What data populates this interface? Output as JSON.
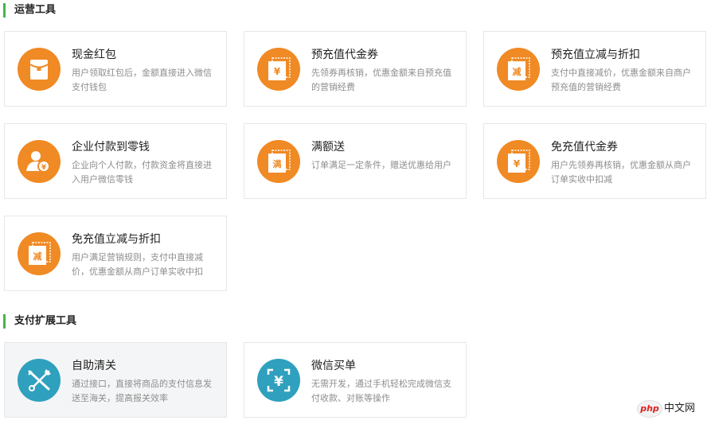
{
  "section1": {
    "title": "运营工具"
  },
  "section2": {
    "title": "支付扩展工具"
  },
  "cards1": [
    {
      "title": "现金红包",
      "desc": "用户领取红包后，金额直接进入微信支付钱包",
      "icon": "red-envelope-icon"
    },
    {
      "title": "预充值代金券",
      "desc": "先领券再核销，优惠金额来自预充值的营销经费",
      "icon": "yen-voucher-icon",
      "glyph": "¥"
    },
    {
      "title": "预充值立减与折扣",
      "desc": "支付中直接减价，优惠金额来自商户预充值的营销经费",
      "icon": "discount-voucher-icon",
      "glyph": "减"
    },
    {
      "title": "企业付款到零钱",
      "desc": "企业向个人付款，付款资金将直接进入用户微信零钱",
      "icon": "enterprise-payment-icon"
    },
    {
      "title": "满额送",
      "desc": "订单满足一定条件，赠送优惠给用户",
      "icon": "full-amount-gift-icon",
      "glyph": "满"
    },
    {
      "title": "免充值代金券",
      "desc": "用户先领券再核销，优惠金额从商户订单实收中扣减",
      "icon": "yen-voucher-icon",
      "glyph": "¥"
    },
    {
      "title": "免充值立减与折扣",
      "desc": "用户满足营销规则，支付中直接减价，优惠金额从商户订单实收中扣",
      "icon": "discount-voucher-icon",
      "glyph": "减"
    }
  ],
  "cards2": [
    {
      "title": "自助清关",
      "desc": "通过接口，直接将商品的支付信息发送至海关，提高报关效率",
      "icon": "customs-clearance-icon"
    },
    {
      "title": "微信买单",
      "desc": "无需开发，通过手机轻松完成微信支付收款、对账等操作",
      "icon": "scan-yen-icon",
      "glyph": "¥"
    }
  ],
  "watermark": {
    "logo": "php",
    "text": "中文网"
  },
  "colors": {
    "accent": "#44b549",
    "orange": "#f08a24",
    "teal": "#2fa0be"
  }
}
